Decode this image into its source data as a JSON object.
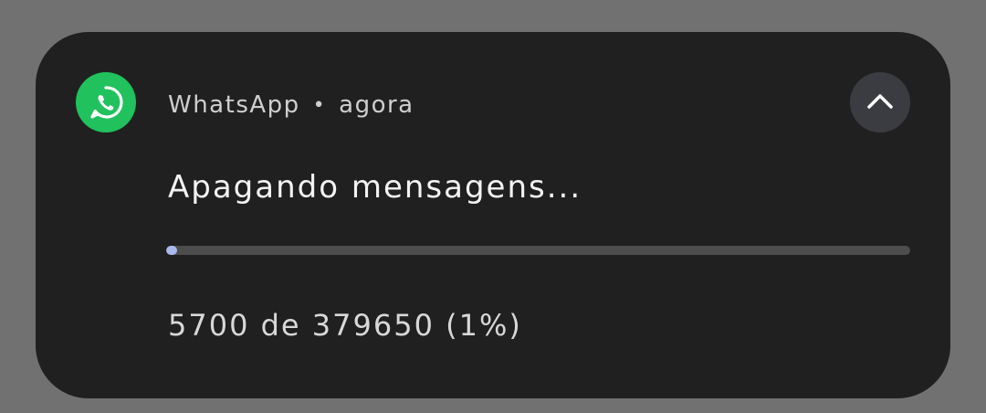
{
  "notification": {
    "app_name": "WhatsApp",
    "separator": "•",
    "time": "agora",
    "title": "Apagando mensagens...",
    "progress": {
      "fraction": 0.015,
      "current": 5700,
      "total": 379650,
      "percent_label": "1%"
    },
    "status_text": "5700 de 379650 (1%)",
    "icons": {
      "app": "whatsapp-icon",
      "collapse": "chevron-up-icon"
    },
    "colors": {
      "background": "#717171",
      "card": "#202020",
      "app_icon": "#21c15d",
      "progress_fill": "#a9b9ef",
      "progress_track": "#4d4d4d"
    }
  }
}
